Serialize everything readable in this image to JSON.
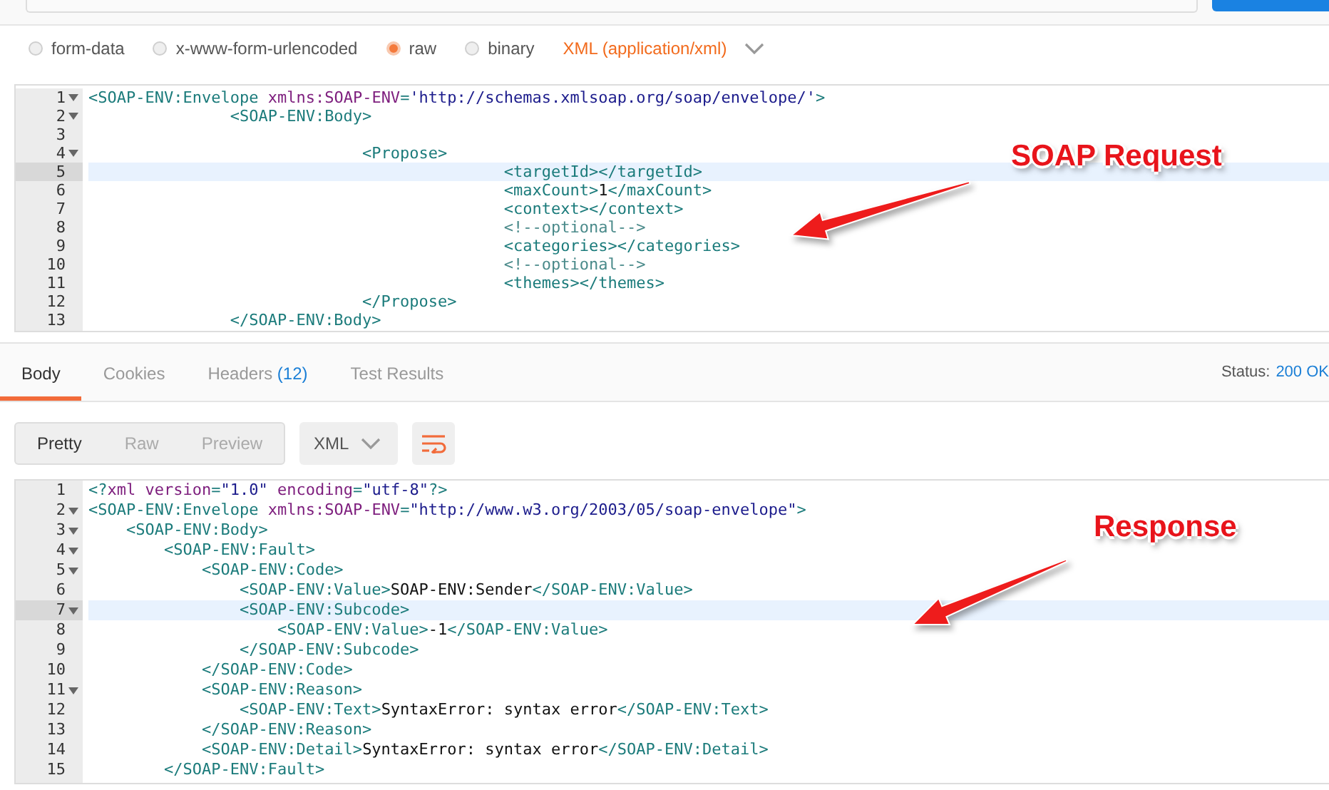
{
  "body_types": [
    {
      "label": "form-data",
      "selected": false
    },
    {
      "label": "x-www-form-urlencoded",
      "selected": false
    },
    {
      "label": "raw",
      "selected": true
    },
    {
      "label": "binary",
      "selected": false
    }
  ],
  "content_type": {
    "label": "XML (application/xml)"
  },
  "request_editor": {
    "lines": [
      {
        "number": "1",
        "fold": true,
        "highlighted": false,
        "segments": [
          {
            "kind": "tag",
            "text": "<SOAP-ENV:Envelope "
          },
          {
            "kind": "attr",
            "text": "xmlns:SOAP-ENV"
          },
          {
            "kind": "tag",
            "text": "="
          },
          {
            "kind": "string",
            "text": "'http://schemas.xmlsoap.org/soap/envelope/'"
          },
          {
            "kind": "tag",
            "text": ">"
          }
        ]
      },
      {
        "number": "2",
        "fold": true,
        "highlighted": false,
        "segments": [
          {
            "kind": "tag",
            "text": "               <SOAP-ENV:Body>"
          }
        ]
      },
      {
        "number": "3",
        "fold": false,
        "highlighted": false
      },
      {
        "number": "4",
        "fold": true,
        "highlighted": false,
        "segments": [
          {
            "kind": "tag",
            "text": "                             <Propose>"
          }
        ]
      },
      {
        "number": "5",
        "fold": false,
        "highlighted": true,
        "segments": [
          {
            "kind": "tag",
            "text": "                                            <targetId></targetId>"
          }
        ]
      },
      {
        "number": "6",
        "fold": false,
        "highlighted": false,
        "segments": [
          {
            "kind": "tag",
            "text": "                                            <maxCount>"
          },
          {
            "kind": "text",
            "text": "1"
          },
          {
            "kind": "tag",
            "text": "</maxCount>"
          }
        ]
      },
      {
        "number": "7",
        "fold": false,
        "highlighted": false,
        "segments": [
          {
            "kind": "tag",
            "text": "                                            <context></context>"
          }
        ]
      },
      {
        "number": "8",
        "fold": false,
        "highlighted": false,
        "segments": [
          {
            "kind": "comment",
            "text": "                                            <!--optional-->"
          }
        ]
      },
      {
        "number": "9",
        "fold": false,
        "highlighted": false,
        "segments": [
          {
            "kind": "tag",
            "text": "                                            <categories></categories>"
          }
        ]
      },
      {
        "number": "10",
        "fold": false,
        "highlighted": false,
        "segments": [
          {
            "kind": "comment",
            "text": "                                            <!--optional-->"
          }
        ]
      },
      {
        "number": "11",
        "fold": false,
        "highlighted": false,
        "segments": [
          {
            "kind": "tag",
            "text": "                                            <themes></themes>"
          }
        ]
      },
      {
        "number": "12",
        "fold": false,
        "highlighted": false,
        "segments": [
          {
            "kind": "tag",
            "text": "                             </Propose>"
          }
        ]
      },
      {
        "number": "13",
        "fold": false,
        "highlighted": false,
        "segments": [
          {
            "kind": "tag",
            "text": "               </SOAP-ENV:Body>"
          }
        ]
      }
    ]
  },
  "response_tabs": [
    {
      "label": "Body",
      "selected": true
    },
    {
      "label": "Cookies",
      "selected": false
    },
    {
      "label": "Headers",
      "count": "(12)",
      "selected": false
    },
    {
      "label": "Test Results",
      "selected": false
    }
  ],
  "status": {
    "label": "Status:",
    "value": "200 OK"
  },
  "view_modes": [
    {
      "label": "Pretty",
      "selected": true
    },
    {
      "label": "Raw",
      "selected": false
    },
    {
      "label": "Preview",
      "selected": false
    }
  ],
  "format": {
    "label": "XML"
  },
  "response_editor": {
    "lines": [
      {
        "number": "1",
        "fold": false,
        "highlighted": false,
        "segments": [
          {
            "kind": "tag",
            "text": "<?"
          },
          {
            "kind": "attr",
            "text": "xml version"
          },
          {
            "kind": "tag",
            "text": "="
          },
          {
            "kind": "string",
            "text": "\"1.0\""
          },
          {
            "kind": "attr",
            "text": " encoding"
          },
          {
            "kind": "tag",
            "text": "="
          },
          {
            "kind": "string",
            "text": "\"utf-8\""
          },
          {
            "kind": "tag",
            "text": "?>"
          }
        ]
      },
      {
        "number": "2",
        "fold": true,
        "highlighted": false,
        "segments": [
          {
            "kind": "tag",
            "text": "<SOAP-ENV:Envelope "
          },
          {
            "kind": "attr",
            "text": "xmlns:SOAP-ENV"
          },
          {
            "kind": "tag",
            "text": "="
          },
          {
            "kind": "string",
            "text": "\"http://www.w3.org/2003/05/soap-envelope\""
          },
          {
            "kind": "tag",
            "text": ">"
          }
        ]
      },
      {
        "number": "3",
        "fold": true,
        "highlighted": false,
        "segments": [
          {
            "kind": "tag",
            "text": "    <SOAP-ENV:Body>"
          }
        ]
      },
      {
        "number": "4",
        "fold": true,
        "highlighted": false,
        "segments": [
          {
            "kind": "tag",
            "text": "        <SOAP-ENV:Fault>"
          }
        ]
      },
      {
        "number": "5",
        "fold": true,
        "highlighted": false,
        "segments": [
          {
            "kind": "tag",
            "text": "            <SOAP-ENV:Code>"
          }
        ]
      },
      {
        "number": "6",
        "fold": false,
        "highlighted": false,
        "segments": [
          {
            "kind": "tag",
            "text": "                <SOAP-ENV:Value>"
          },
          {
            "kind": "text",
            "text": "SOAP-ENV:Sender"
          },
          {
            "kind": "tag",
            "text": "</SOAP-ENV:Value>"
          }
        ]
      },
      {
        "number": "7",
        "fold": true,
        "highlighted": true,
        "segments": [
          {
            "kind": "tag",
            "text": "                <SOAP-ENV:Subcode>"
          }
        ]
      },
      {
        "number": "8",
        "fold": false,
        "highlighted": false,
        "segments": [
          {
            "kind": "tag",
            "text": "                    <SOAP-ENV:Value>"
          },
          {
            "kind": "text",
            "text": "-1"
          },
          {
            "kind": "tag",
            "text": "</SOAP-ENV:Value>"
          }
        ]
      },
      {
        "number": "9",
        "fold": false,
        "highlighted": false,
        "segments": [
          {
            "kind": "tag",
            "text": "                </SOAP-ENV:Subcode>"
          }
        ]
      },
      {
        "number": "10",
        "fold": false,
        "highlighted": false,
        "segments": [
          {
            "kind": "tag",
            "text": "            </SOAP-ENV:Code>"
          }
        ]
      },
      {
        "number": "11",
        "fold": true,
        "highlighted": false,
        "segments": [
          {
            "kind": "tag",
            "text": "            <SOAP-ENV:Reason>"
          }
        ]
      },
      {
        "number": "12",
        "fold": false,
        "highlighted": false,
        "segments": [
          {
            "kind": "tag",
            "text": "                <SOAP-ENV:Text>"
          },
          {
            "kind": "text",
            "text": "SyntaxError: syntax error"
          },
          {
            "kind": "tag",
            "text": "</SOAP-ENV:Text>"
          }
        ]
      },
      {
        "number": "13",
        "fold": false,
        "highlighted": false,
        "segments": [
          {
            "kind": "tag",
            "text": "            </SOAP-ENV:Reason>"
          }
        ]
      },
      {
        "number": "14",
        "fold": false,
        "highlighted": false,
        "segments": [
          {
            "kind": "tag",
            "text": "            <SOAP-ENV:Detail>"
          },
          {
            "kind": "text",
            "text": "SyntaxError: syntax error"
          },
          {
            "kind": "tag",
            "text": "</SOAP-ENV:Detail>"
          }
        ]
      },
      {
        "number": "15",
        "fold": false,
        "highlighted": false,
        "segments": [
          {
            "kind": "tag",
            "text": "        </SOAP-ENV:Fault>"
          }
        ]
      }
    ]
  },
  "annotations": [
    {
      "text": "SOAP Request"
    },
    {
      "text": "Response"
    }
  ]
}
